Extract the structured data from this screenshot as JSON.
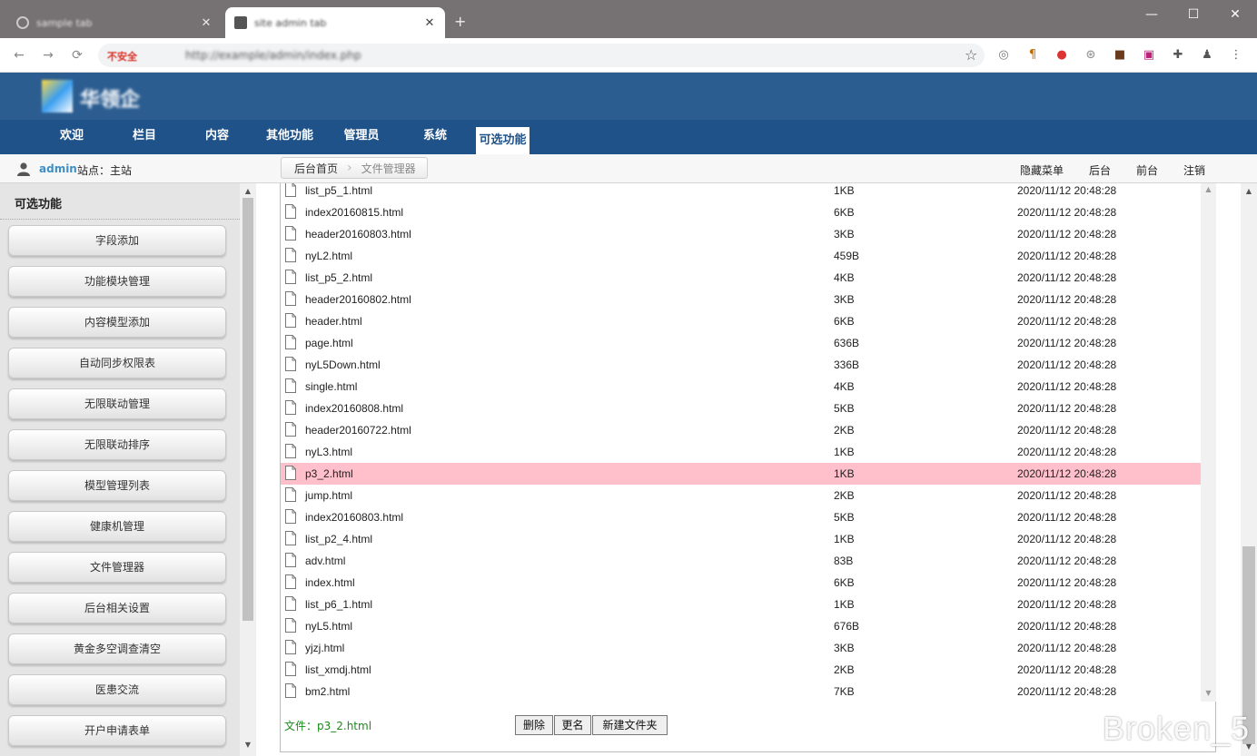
{
  "browser": {
    "tabs": [
      {
        "title": "sample tab",
        "active": false
      },
      {
        "title": "site admin tab",
        "active": true
      }
    ],
    "address": {
      "security_label": "不安全",
      "url": "http://example/admin/index.php"
    }
  },
  "site": {
    "logo_text": "华领企"
  },
  "nav": {
    "items": [
      {
        "label": "欢迎"
      },
      {
        "label": "栏目"
      },
      {
        "label": "内容"
      },
      {
        "label": "其他功能"
      },
      {
        "label": "管理员"
      },
      {
        "label": "系统"
      },
      {
        "label": "可选功能"
      }
    ]
  },
  "infobar": {
    "username": "admin",
    "site_label": "站点：主站",
    "breadcrumb": {
      "home": "后台首页",
      "current": "文件管理器"
    },
    "links": {
      "hide_menu": "隐藏菜单",
      "backend": "后台",
      "frontend": "前台",
      "logout": "注销"
    }
  },
  "sidebar": {
    "title": "可选功能",
    "items": [
      {
        "label": "字段添加"
      },
      {
        "label": "功能模块管理"
      },
      {
        "label": "内容模型添加"
      },
      {
        "label": "自动同步权限表"
      },
      {
        "label": "无限联动管理"
      },
      {
        "label": "无限联动排序"
      },
      {
        "label": "模型管理列表"
      },
      {
        "label": "健康机管理"
      },
      {
        "label": "文件管理器"
      },
      {
        "label": "后台相关设置"
      },
      {
        "label": "黄金多空调查清空"
      },
      {
        "label": "医患交流"
      },
      {
        "label": "开户申请表单"
      }
    ]
  },
  "files": {
    "rows": [
      {
        "name": "list_p5_1.html",
        "size": "1KB",
        "date": "2020/11/12 20:48:28"
      },
      {
        "name": "index20160815.html",
        "size": "6KB",
        "date": "2020/11/12 20:48:28"
      },
      {
        "name": "header20160803.html",
        "size": "3KB",
        "date": "2020/11/12 20:48:28"
      },
      {
        "name": "nyL2.html",
        "size": "459B",
        "date": "2020/11/12 20:48:28"
      },
      {
        "name": "list_p5_2.html",
        "size": "4KB",
        "date": "2020/11/12 20:48:28"
      },
      {
        "name": "header20160802.html",
        "size": "3KB",
        "date": "2020/11/12 20:48:28"
      },
      {
        "name": "header.html",
        "size": "6KB",
        "date": "2020/11/12 20:48:28"
      },
      {
        "name": "page.html",
        "size": "636B",
        "date": "2020/11/12 20:48:28"
      },
      {
        "name": "nyL5Down.html",
        "size": "336B",
        "date": "2020/11/12 20:48:28"
      },
      {
        "name": "single.html",
        "size": "4KB",
        "date": "2020/11/12 20:48:28"
      },
      {
        "name": "index20160808.html",
        "size": "5KB",
        "date": "2020/11/12 20:48:28"
      },
      {
        "name": "header20160722.html",
        "size": "2KB",
        "date": "2020/11/12 20:48:28"
      },
      {
        "name": "nyL3.html",
        "size": "1KB",
        "date": "2020/11/12 20:48:28"
      },
      {
        "name": "p3_2.html",
        "size": "1KB",
        "date": "2020/11/12 20:48:28",
        "selected": true
      },
      {
        "name": "jump.html",
        "size": "2KB",
        "date": "2020/11/12 20:48:28"
      },
      {
        "name": "index20160803.html",
        "size": "5KB",
        "date": "2020/11/12 20:48:28"
      },
      {
        "name": "list_p2_4.html",
        "size": "1KB",
        "date": "2020/11/12 20:48:28"
      },
      {
        "name": "adv.html",
        "size": "83B",
        "date": "2020/11/12 20:48:28"
      },
      {
        "name": "index.html",
        "size": "6KB",
        "date": "2020/11/12 20:48:28"
      },
      {
        "name": "list_p6_1.html",
        "size": "1KB",
        "date": "2020/11/12 20:48:28"
      },
      {
        "name": "nyL5.html",
        "size": "676B",
        "date": "2020/11/12 20:48:28"
      },
      {
        "name": "yjzj.html",
        "size": "3KB",
        "date": "2020/11/12 20:48:28"
      },
      {
        "name": "list_xmdj.html",
        "size": "2KB",
        "date": "2020/11/12 20:48:28"
      },
      {
        "name": "bm2.html",
        "size": "7KB",
        "date": "2020/11/12 20:48:28"
      }
    ],
    "status": "文件：p3_2.html",
    "actions": {
      "delete": "删除",
      "rename": "更名",
      "new_folder": "新建文件夹"
    }
  },
  "watermark": "Broken_5",
  "colors": {
    "header_bg": "#2b5d91",
    "nav_bg": "#1f5289",
    "selected_row": "#ffc0cb",
    "username": "#3d8fc4",
    "status_text": "#1a8a1a"
  }
}
